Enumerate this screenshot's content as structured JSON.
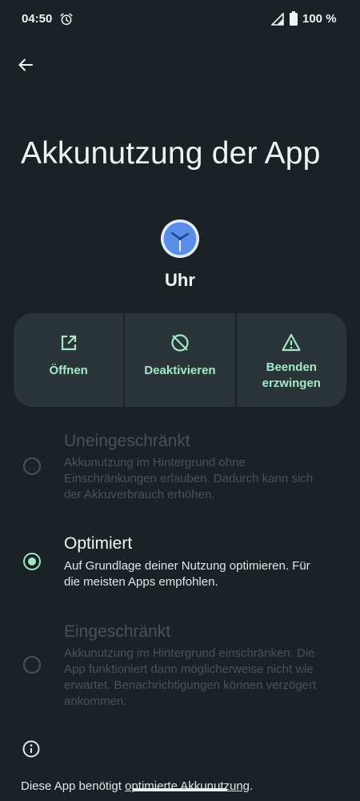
{
  "status_bar": {
    "time": "04:50",
    "battery": "100 %"
  },
  "header": {
    "title": "Akkunutzung der App"
  },
  "app": {
    "name": "Uhr"
  },
  "actions": [
    {
      "label": "Öffnen",
      "icon": "open-external-icon"
    },
    {
      "label": "Deaktivieren",
      "icon": "disable-icon"
    },
    {
      "label": "Beenden erzwingen",
      "icon": "warning-icon"
    }
  ],
  "options": [
    {
      "title": "Uneingeschränkt",
      "description": "Akkunutzung im Hintergrund ohne Einschränkungen erlauben. Dadurch kann sich der Akkuverbrauch erhöhen.",
      "selected": false,
      "enabled": false
    },
    {
      "title": "Optimiert",
      "description": "Auf Grundlage deiner Nutzung optimieren. Für die meisten Apps empfohlen.",
      "selected": true,
      "enabled": true
    },
    {
      "title": "Eingeschränkt",
      "description": "Akkunutzung im Hintergrund einschränken. Die App funktioniert dann möglicherweise nicht wie erwartet. Benachrichtigungen können verzögert ankommen.",
      "selected": false,
      "enabled": false
    }
  ],
  "footer": {
    "text": "Diese App benötigt ",
    "link": "optimierte Akkunutzung",
    "suffix": "."
  },
  "colors": {
    "background": "#1b2226",
    "card": "#2b3438",
    "accent": "#a4e8c8",
    "disabled_text": "#48525a"
  }
}
